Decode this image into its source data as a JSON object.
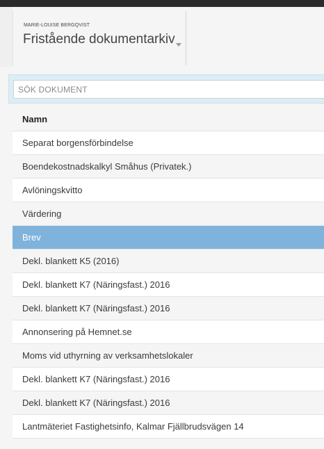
{
  "header": {
    "user_name": "MARIE-LOUISE BERGQVIST",
    "archive_name": "Fristående dokumentarkiv",
    "chevron_icon": "chevron-down-icon"
  },
  "search": {
    "placeholder": "SÖK DOKUMENT",
    "value": ""
  },
  "table": {
    "column_header": "Namn",
    "selected_index": 4,
    "rows": [
      "Separat borgensförbindelse",
      "Boendekostnadskalkyl Småhus (Privatek.)",
      "Avlöningskvitto",
      "Värdering",
      "Brev",
      "Dekl. blankett K5 (2016)",
      "Dekl. blankett K7 (Näringsfast.) 2016",
      "Dekl. blankett K7 (Näringsfast.) 2016",
      "Annonsering på Hemnet.se",
      "Moms vid uthyrning av verksamhetslokaler",
      "Dekl. blankett K7 (Näringsfast.) 2016",
      "Dekl. blankett K7 (Näringsfast.) 2016",
      "Lantmäteriet Fastighetsinfo, Kalmar Fjällbrudsvägen 14"
    ]
  },
  "colors": {
    "selected_row": "#7fb3dc",
    "top_bar": "#2b2b2b",
    "search_frame": "#dceef5"
  }
}
